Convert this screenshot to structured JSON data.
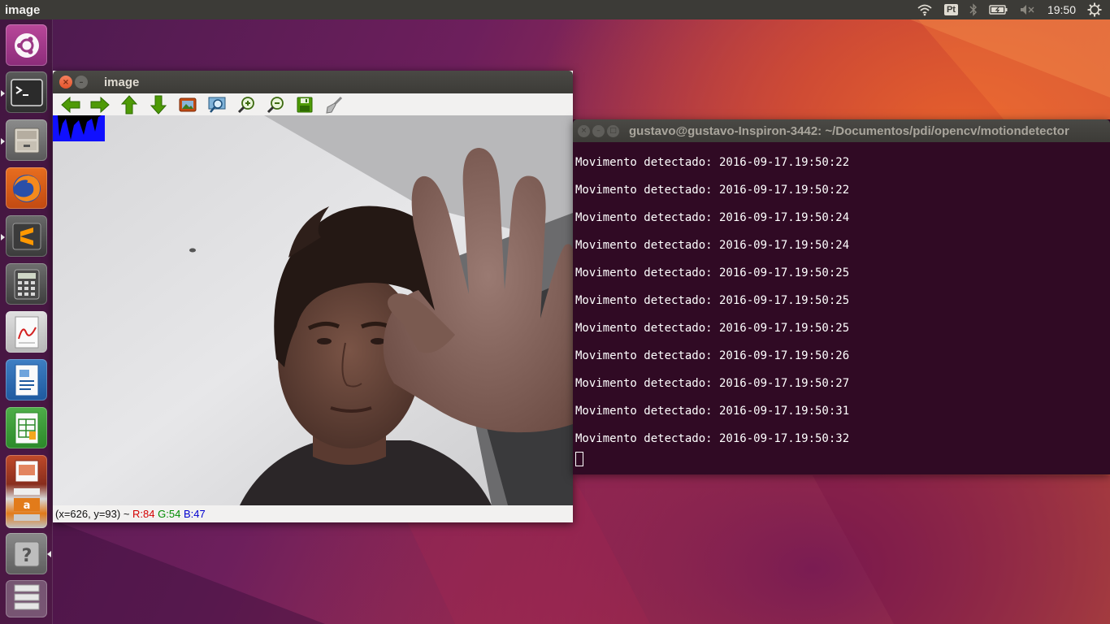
{
  "panel": {
    "app_title": "image",
    "keyboard_layout": "Pt",
    "clock": "19:50"
  },
  "launcher": {
    "items": [
      {
        "name": "dash-home",
        "icon": "ubuntu-logo-icon"
      },
      {
        "name": "terminal",
        "icon": "terminal-icon"
      },
      {
        "name": "files",
        "icon": "file-cabinet-icon"
      },
      {
        "name": "firefox",
        "icon": "firefox-icon"
      },
      {
        "name": "sublime-text",
        "icon": "sublime-text-icon"
      },
      {
        "name": "calculator",
        "icon": "calculator-icon"
      },
      {
        "name": "document-viewer",
        "icon": "pdf-viewer-icon"
      },
      {
        "name": "libreoffice-writer",
        "icon": "writer-icon"
      },
      {
        "name": "libreoffice-calc",
        "icon": "calc-icon"
      },
      {
        "name": "stacked-apps",
        "icon": "impress-amazon-stack-icon"
      },
      {
        "name": "help",
        "icon": "help-icon"
      },
      {
        "name": "workspaces",
        "icon": "workspace-switcher-icon"
      }
    ]
  },
  "image_window": {
    "title": "image",
    "toolbar": [
      "arrow-left-icon",
      "arrow-right-icon",
      "arrow-up-icon",
      "arrow-down-icon",
      "image-icon",
      "zoom-fit-icon",
      "zoom-in-icon",
      "zoom-out-icon",
      "save-icon",
      "properties-brush-icon"
    ],
    "status": {
      "coords": "(x=626, y=93) ~ ",
      "r": "R:84",
      "g": "G:54",
      "b": "B:47"
    },
    "colors": {
      "r": "#d40000",
      "g": "#008a00",
      "b": "#0000d0"
    }
  },
  "terminal": {
    "title": "gustavo@gustavo-Inspiron-3442: ~/Documentos/pdi/opencv/motiondetector",
    "lines": [
      "Movimento detectado: 2016-09-17.19:50:22",
      "Movimento detectado: 2016-09-17.19:50:22",
      "Movimento detectado: 2016-09-17.19:50:24",
      "Movimento detectado: 2016-09-17.19:50:24",
      "Movimento detectado: 2016-09-17.19:50:25",
      "Movimento detectado: 2016-09-17.19:50:25",
      "Movimento detectado: 2016-09-17.19:50:25",
      "Movimento detectado: 2016-09-17.19:50:26",
      "Movimento detectado: 2016-09-17.19:50:27",
      "Movimento detectado: 2016-09-17.19:50:31",
      "Movimento detectado: 2016-09-17.19:50:32"
    ]
  }
}
